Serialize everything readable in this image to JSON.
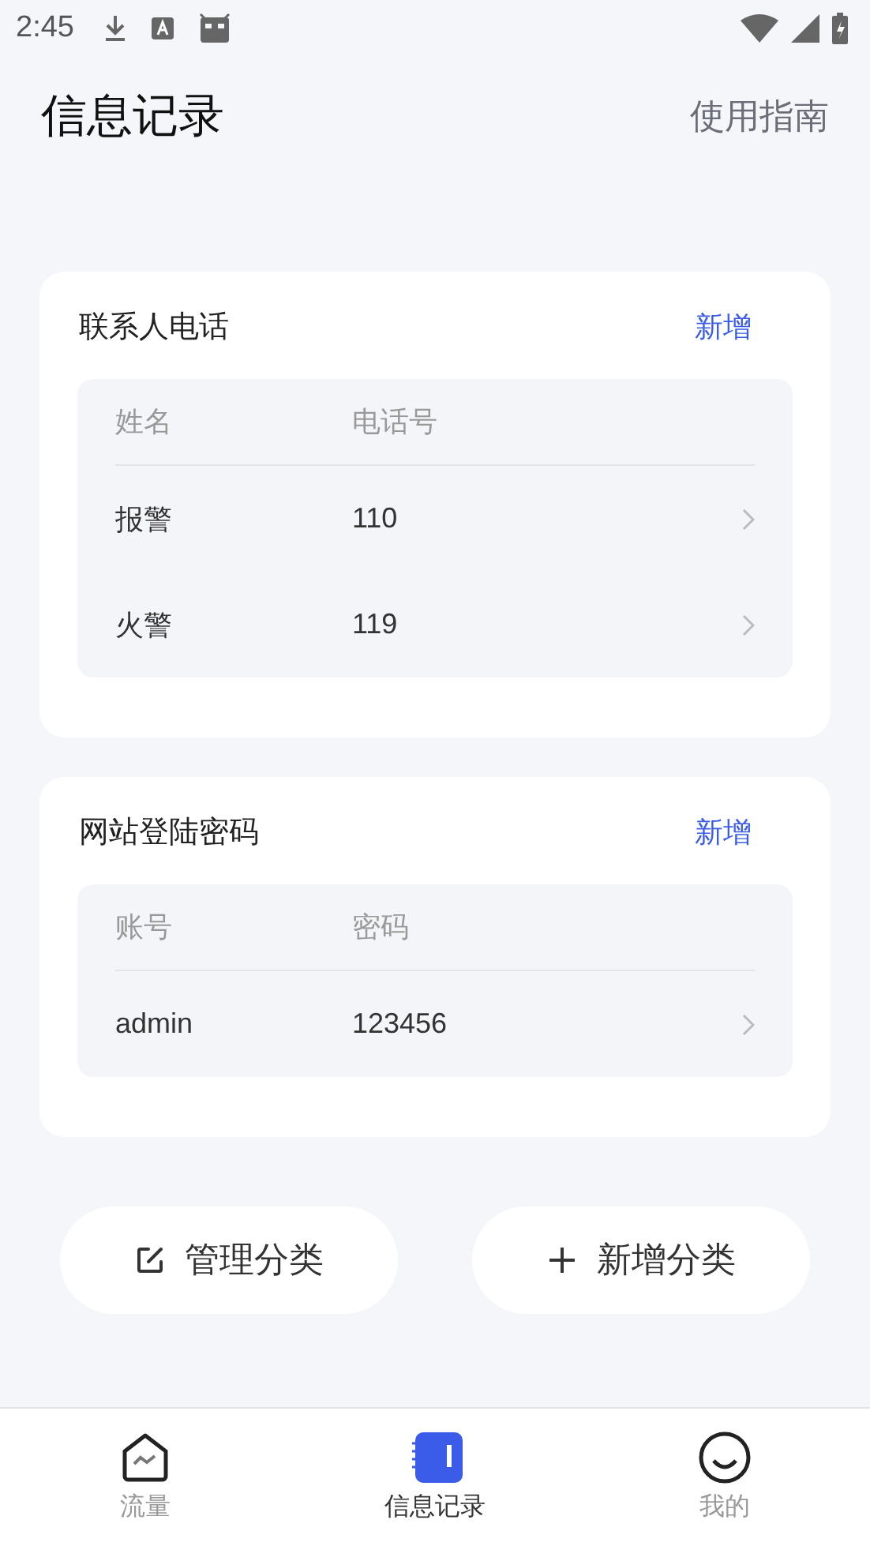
{
  "status_bar": {
    "time": "2:45"
  },
  "header": {
    "title": "信息记录",
    "action": "使用指南"
  },
  "sections": [
    {
      "title": "联系人电话",
      "action": "新增",
      "columns": [
        "姓名",
        "电话号"
      ],
      "rows": [
        {
          "cells": [
            "报警",
            "110"
          ]
        },
        {
          "cells": [
            "火警",
            "119"
          ]
        }
      ]
    },
    {
      "title": "网站登陆密码",
      "action": "新增",
      "columns": [
        "账号",
        "密码"
      ],
      "rows": [
        {
          "cells": [
            "admin",
            "123456"
          ]
        }
      ]
    }
  ],
  "buttons": [
    {
      "kind": "edit",
      "label": "管理分类"
    },
    {
      "kind": "add",
      "label": "新增分类"
    }
  ],
  "tabs": [
    {
      "kind": "traffic",
      "label": "流量",
      "selected": false
    },
    {
      "kind": "notes",
      "label": "信息记录",
      "selected": true
    },
    {
      "kind": "profile",
      "label": "我的",
      "selected": false
    }
  ]
}
